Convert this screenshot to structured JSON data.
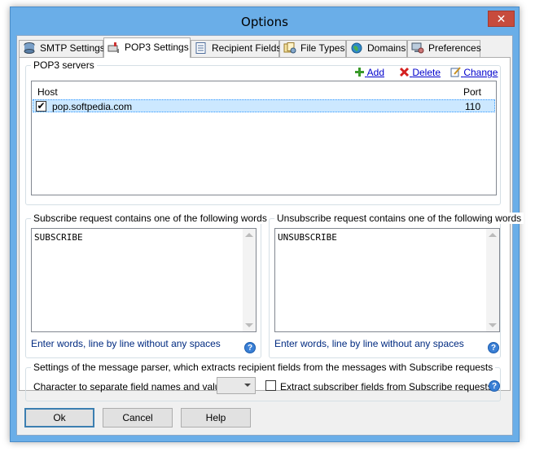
{
  "window": {
    "title": "Options",
    "close_glyph": "✕"
  },
  "tabs": [
    {
      "label": "SMTP Settings",
      "icon": "database-icon"
    },
    {
      "label": "POP3 Settings",
      "icon": "mailbox-icon",
      "active": true
    },
    {
      "label": "Recipient Fields",
      "icon": "document-list-icon"
    },
    {
      "label": "File Types",
      "icon": "files-icon"
    },
    {
      "label": "Domains",
      "icon": "globe-icon"
    },
    {
      "label": "Preferences",
      "icon": "computer-settings-icon"
    }
  ],
  "pop3": {
    "group_label": "POP3 servers",
    "add_label": "Add",
    "delete_label": "Delete",
    "change_label": "Change",
    "columns": {
      "host": "Host",
      "port": "Port"
    },
    "servers": [
      {
        "host": "pop.softpedia.com",
        "port": "110",
        "checked": true
      }
    ]
  },
  "subscribe": {
    "group_label": "Subscribe request contains one of the following words",
    "value": "SUBSCRIBE",
    "hint": "Enter words, line by line without any spaces"
  },
  "unsubscribe": {
    "group_label": "Unsubscribe request contains one of the following words",
    "value": "UNSUBSCRIBE",
    "hint": "Enter words, line by line without any spaces"
  },
  "parser": {
    "group_label": "Settings of the message parser, which extracts recipient fields from the messages with Subscribe requests",
    "separator_label": "Character to separate field names and values :",
    "separator_value": "",
    "extract_label": "Extract subscriber fields from Subscribe requests",
    "extract_checked": false
  },
  "buttons": {
    "ok": "Ok",
    "cancel": "Cancel",
    "help": "Help"
  },
  "help_glyph": "?",
  "colors": {
    "titlebar": "#6aaee8",
    "close": "#c74b3d",
    "link": "#0000cc",
    "hint": "#002a80",
    "selection": "#cce8ff"
  }
}
